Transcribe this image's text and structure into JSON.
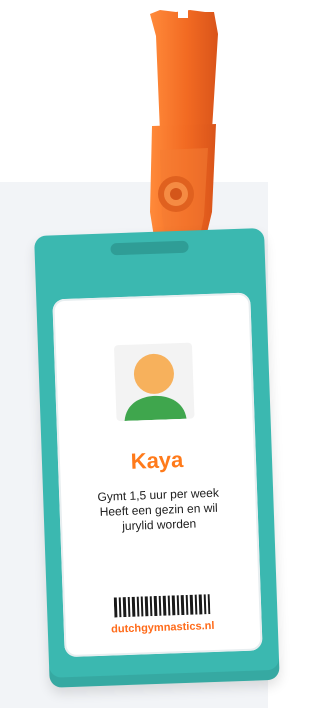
{
  "colors": {
    "lanyard": "#f26a22",
    "card": "#3bb8b0",
    "accent": "#ff7a1a",
    "avatar_head": "#f7b15c",
    "avatar_body": "#3fa64d"
  },
  "badge": {
    "name": "Kaya",
    "description_lines": [
      "Gymt 1,5 uur per week",
      "Heeft een gezin en wil",
      "jurylid worden"
    ],
    "website": "dutchgymnastics.nl",
    "avatar_icon": "person-avatar-icon"
  }
}
